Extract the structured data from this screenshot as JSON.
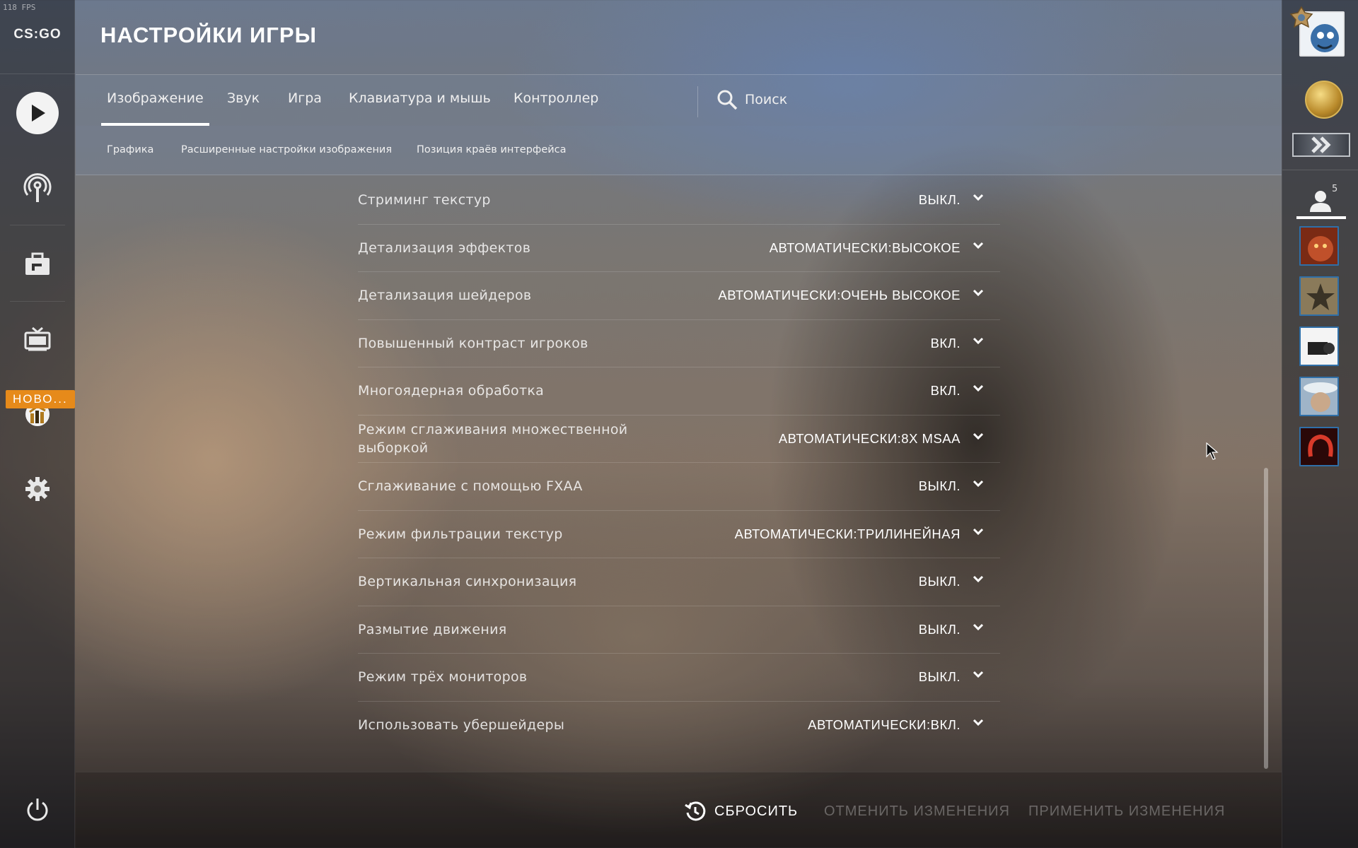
{
  "fps": "118 FPS",
  "app": {
    "logo": "CS:GO"
  },
  "header": {
    "title": "НАСТРОЙКИ ИГРЫ"
  },
  "tabs": [
    {
      "label": "Изображение",
      "active": true
    },
    {
      "label": "Звук",
      "active": false
    },
    {
      "label": "Игра",
      "active": false
    },
    {
      "label": "Клавиатура и мышь",
      "active": false
    },
    {
      "label": "Контроллер",
      "active": false
    }
  ],
  "search": {
    "label": "Поиск",
    "icon": "search-icon"
  },
  "subtabs": [
    {
      "label": "Графика"
    },
    {
      "label": "Расширенные настройки изображения"
    },
    {
      "label": "Позиция краёв интерфейса"
    }
  ],
  "settings": [
    {
      "label": "Стриминг текстур",
      "value": "ВЫКЛ."
    },
    {
      "label": "Детализация эффектов",
      "value": "АВТОМАТИЧЕСКИ:ВЫСОКОЕ"
    },
    {
      "label": "Детализация шейдеров",
      "value": "АВТОМАТИЧЕСКИ:ОЧЕНЬ ВЫСОКОЕ"
    },
    {
      "label": "Повышенный контраст игроков",
      "value": "ВКЛ."
    },
    {
      "label": "Многоядерная обработка",
      "value": "ВКЛ."
    },
    {
      "label": "Режим сглаживания множественной выборкой",
      "value": "АВТОМАТИЧЕСКИ:8X MSAA"
    },
    {
      "label": "Сглаживание с помощью FXAA",
      "value": "ВЫКЛ."
    },
    {
      "label": "Режим фильтрации текстур",
      "value": "АВТОМАТИЧЕСКИ:ТРИЛИНЕЙНАЯ"
    },
    {
      "label": "Вертикальная синхронизация",
      "value": "ВЫКЛ."
    },
    {
      "label": "Размытие движения",
      "value": "ВЫКЛ."
    },
    {
      "label": "Режим трёх мониторов",
      "value": "ВЫКЛ."
    },
    {
      "label": "Использовать убершейдеры",
      "value": "АВТОМАТИЧЕСКИ:ВКЛ."
    }
  ],
  "footer": {
    "reset": "СБРОСИТЬ",
    "discard": "ОТМЕНИТЬ ИЗМЕНЕНИЯ",
    "apply": "ПРИМЕНИТЬ ИЗМЕНЕНИЯ"
  },
  "left_nav": {
    "new_badge": "НОВО..."
  },
  "right_sidebar": {
    "friends_count": "5"
  },
  "colors": {
    "accent_badge": "#e68a1a",
    "friend_border": "#2f6fa8",
    "text_primary": "#ffffff",
    "text_disabled": "rgba(255,255,255,0.3)"
  }
}
